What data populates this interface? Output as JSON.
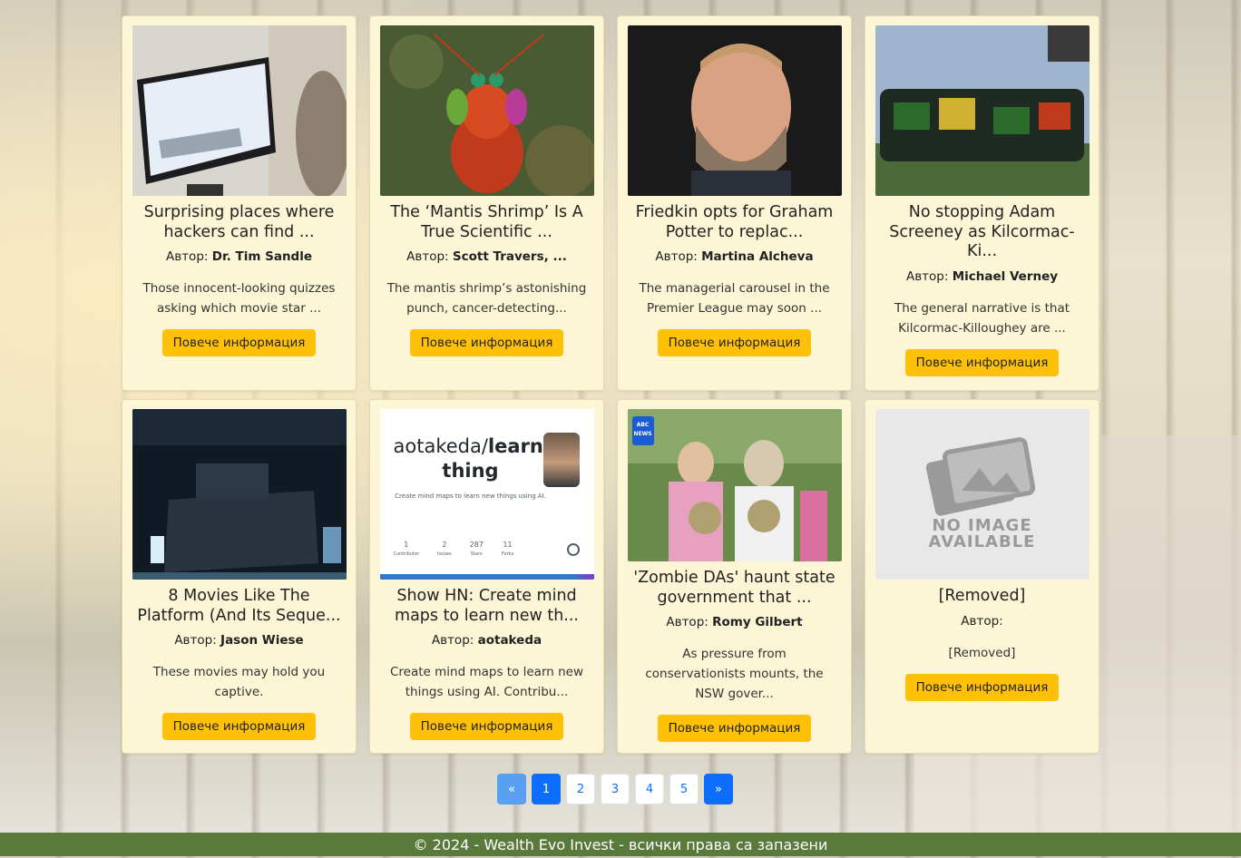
{
  "cards": [
    {
      "title": "Surprising places where hackers can find ...",
      "author_label": "Автор:",
      "author": "Dr. Tim Sandle",
      "desc": "Those innocent-looking quizzes asking which movie star ...",
      "button": "Повече информация"
    },
    {
      "title": "The ‘Mantis Shrimp’ Is A True Scientific ...",
      "author_label": "Автор:",
      "author": "Scott Travers, ...",
      "desc": "The mantis shrimp’s astonishing punch, cancer-detecting...",
      "button": "Повече информация"
    },
    {
      "title": "Friedkin opts for Graham Potter to replac...",
      "author_label": "Автор:",
      "author": "Martina Alcheva",
      "desc": "The managerial carousel in the Premier League may soon ...",
      "button": "Повече информация"
    },
    {
      "title": "No stopping Adam Screeney as Kilcormac-Ki...",
      "author_label": "Автор:",
      "author": "Michael Verney",
      "desc": "The general narrative is that Kilcormac-Killoughey are ...",
      "button": "Повече информация"
    },
    {
      "title": "8 Movies Like The Platform (And Its Seque...",
      "author_label": "Автор:",
      "author": "Jason Wiese",
      "desc": "These movies may hold you captive.",
      "button": "Повече информация"
    },
    {
      "title": "Show HN: Create mind maps to learn new th...",
      "author_label": "Автор:",
      "author": "aotakeda",
      "desc": "Create mind maps to learn new things using AI. Contribu...",
      "button": "Повече информация"
    },
    {
      "title": "'Zombie DAs' haunt state government that ...",
      "author_label": "Автор:",
      "author": "Romy Gilbert",
      "desc": "As pressure from conservationists mounts, the NSW gover...",
      "button": "Повече информация"
    },
    {
      "title": "[Removed]",
      "author_label": "Автор:",
      "author": "",
      "desc": "[Removed]",
      "button": "Повече информация"
    }
  ],
  "github_card": {
    "repo_user": "aotakeda/",
    "repo_name": "learn-thing",
    "subtitle": "Create mind maps to learn new things using AI.",
    "stats": [
      {
        "v": "1",
        "l": "Contributor"
      },
      {
        "v": "2",
        "l": "Issues"
      },
      {
        "v": "287",
        "l": "Stars"
      },
      {
        "v": "11",
        "l": "Forks"
      }
    ]
  },
  "abc_badge": {
    "top": "ABC",
    "bottom": "NEWS"
  },
  "no_image": {
    "line1": "NO IMAGE",
    "line2": "AVAILABLE"
  },
  "pagination": {
    "prev": "«",
    "pages": [
      "1",
      "2",
      "3",
      "4",
      "5"
    ],
    "active": "1",
    "next": "»"
  },
  "footer": "© 2024 - Wealth Evo Invest - всички права са запазени"
}
